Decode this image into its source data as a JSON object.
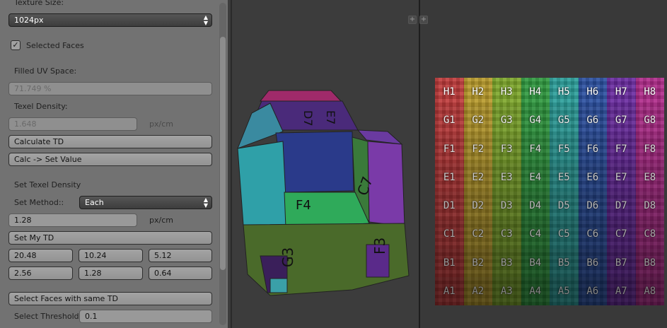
{
  "panel": {
    "texture_size_label": "Texture Size:",
    "texture_size_value": "1024px",
    "selected_faces_label": "Selected Faces",
    "selected_faces_checked": true,
    "filled_uv_label": "Filled UV Space:",
    "filled_uv_value": "71.749 %",
    "texel_density_label": "Texel Density:",
    "texel_density_value": "1.648",
    "texel_density_unit": "px/cm",
    "calculate_td": "Calculate TD",
    "calc_set_value": "Calc -> Set Value",
    "set_texel_density_label": "Set Texel Density",
    "set_method_label": "Set Method::",
    "set_method_value": "Each",
    "set_value": "1.28",
    "set_value_unit": "px/cm",
    "set_my_td": "Set My TD",
    "presets": [
      "20.48",
      "10.24",
      "5.12",
      "2.56",
      "1.28",
      "0.64"
    ],
    "select_faces_same_td": "Select Faces with same TD",
    "select_threshold_label": "Select Threshold:",
    "select_threshold_value": "0.1"
  },
  "viewport": {
    "face_labels": [
      "D7",
      "E7",
      "C7",
      "F4",
      "G3",
      "F3"
    ]
  },
  "uv_editor": {
    "rows": [
      "H",
      "G",
      "F",
      "E",
      "D",
      "C",
      "B",
      "A"
    ],
    "columns": [
      "1",
      "2",
      "3",
      "4",
      "5",
      "6",
      "7",
      "8"
    ],
    "column_colors": [
      "#c03a3a",
      "#b89a2a",
      "#7ea82a",
      "#2f9a3f",
      "#2a9e9a",
      "#2a4fa0",
      "#6a2aa0",
      "#b02a8a"
    ]
  }
}
